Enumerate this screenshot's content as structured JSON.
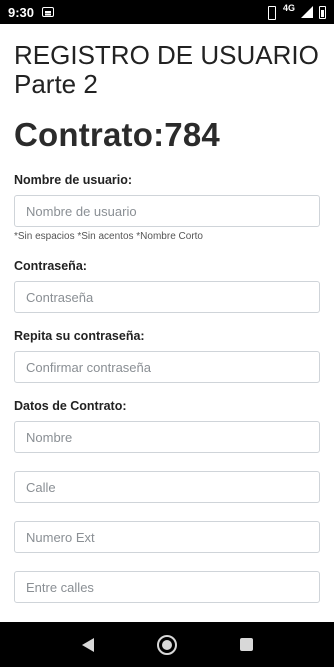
{
  "status_bar": {
    "time": "9:30",
    "network": "4G",
    "icons": [
      "notification-icon",
      "vibrate-icon",
      "signal-icon",
      "battery-icon"
    ]
  },
  "header": {
    "title_line1": "REGISTRO DE USUARIO",
    "title_line2": "Parte 2",
    "contract_label": "Contrato:784"
  },
  "form": {
    "username_label": "Nombre de usuario:",
    "username_placeholder": "Nombre de usuario",
    "username_hint": "*Sin espacios *Sin acentos *Nombre Corto",
    "password_label": "Contraseña:",
    "password_placeholder": "Contraseña",
    "confirm_label": "Repita su contraseña:",
    "confirm_placeholder": "Confirmar contraseña",
    "contract_section_label": "Datos de Contrato:",
    "name_placeholder": "Nombre",
    "street_placeholder": "Calle",
    "number_placeholder": "Numero Ext",
    "cross_streets_placeholder": "Entre calles"
  },
  "nav_bar": {
    "icons": [
      "back-icon",
      "home-icon",
      "recent-apps-icon"
    ]
  }
}
